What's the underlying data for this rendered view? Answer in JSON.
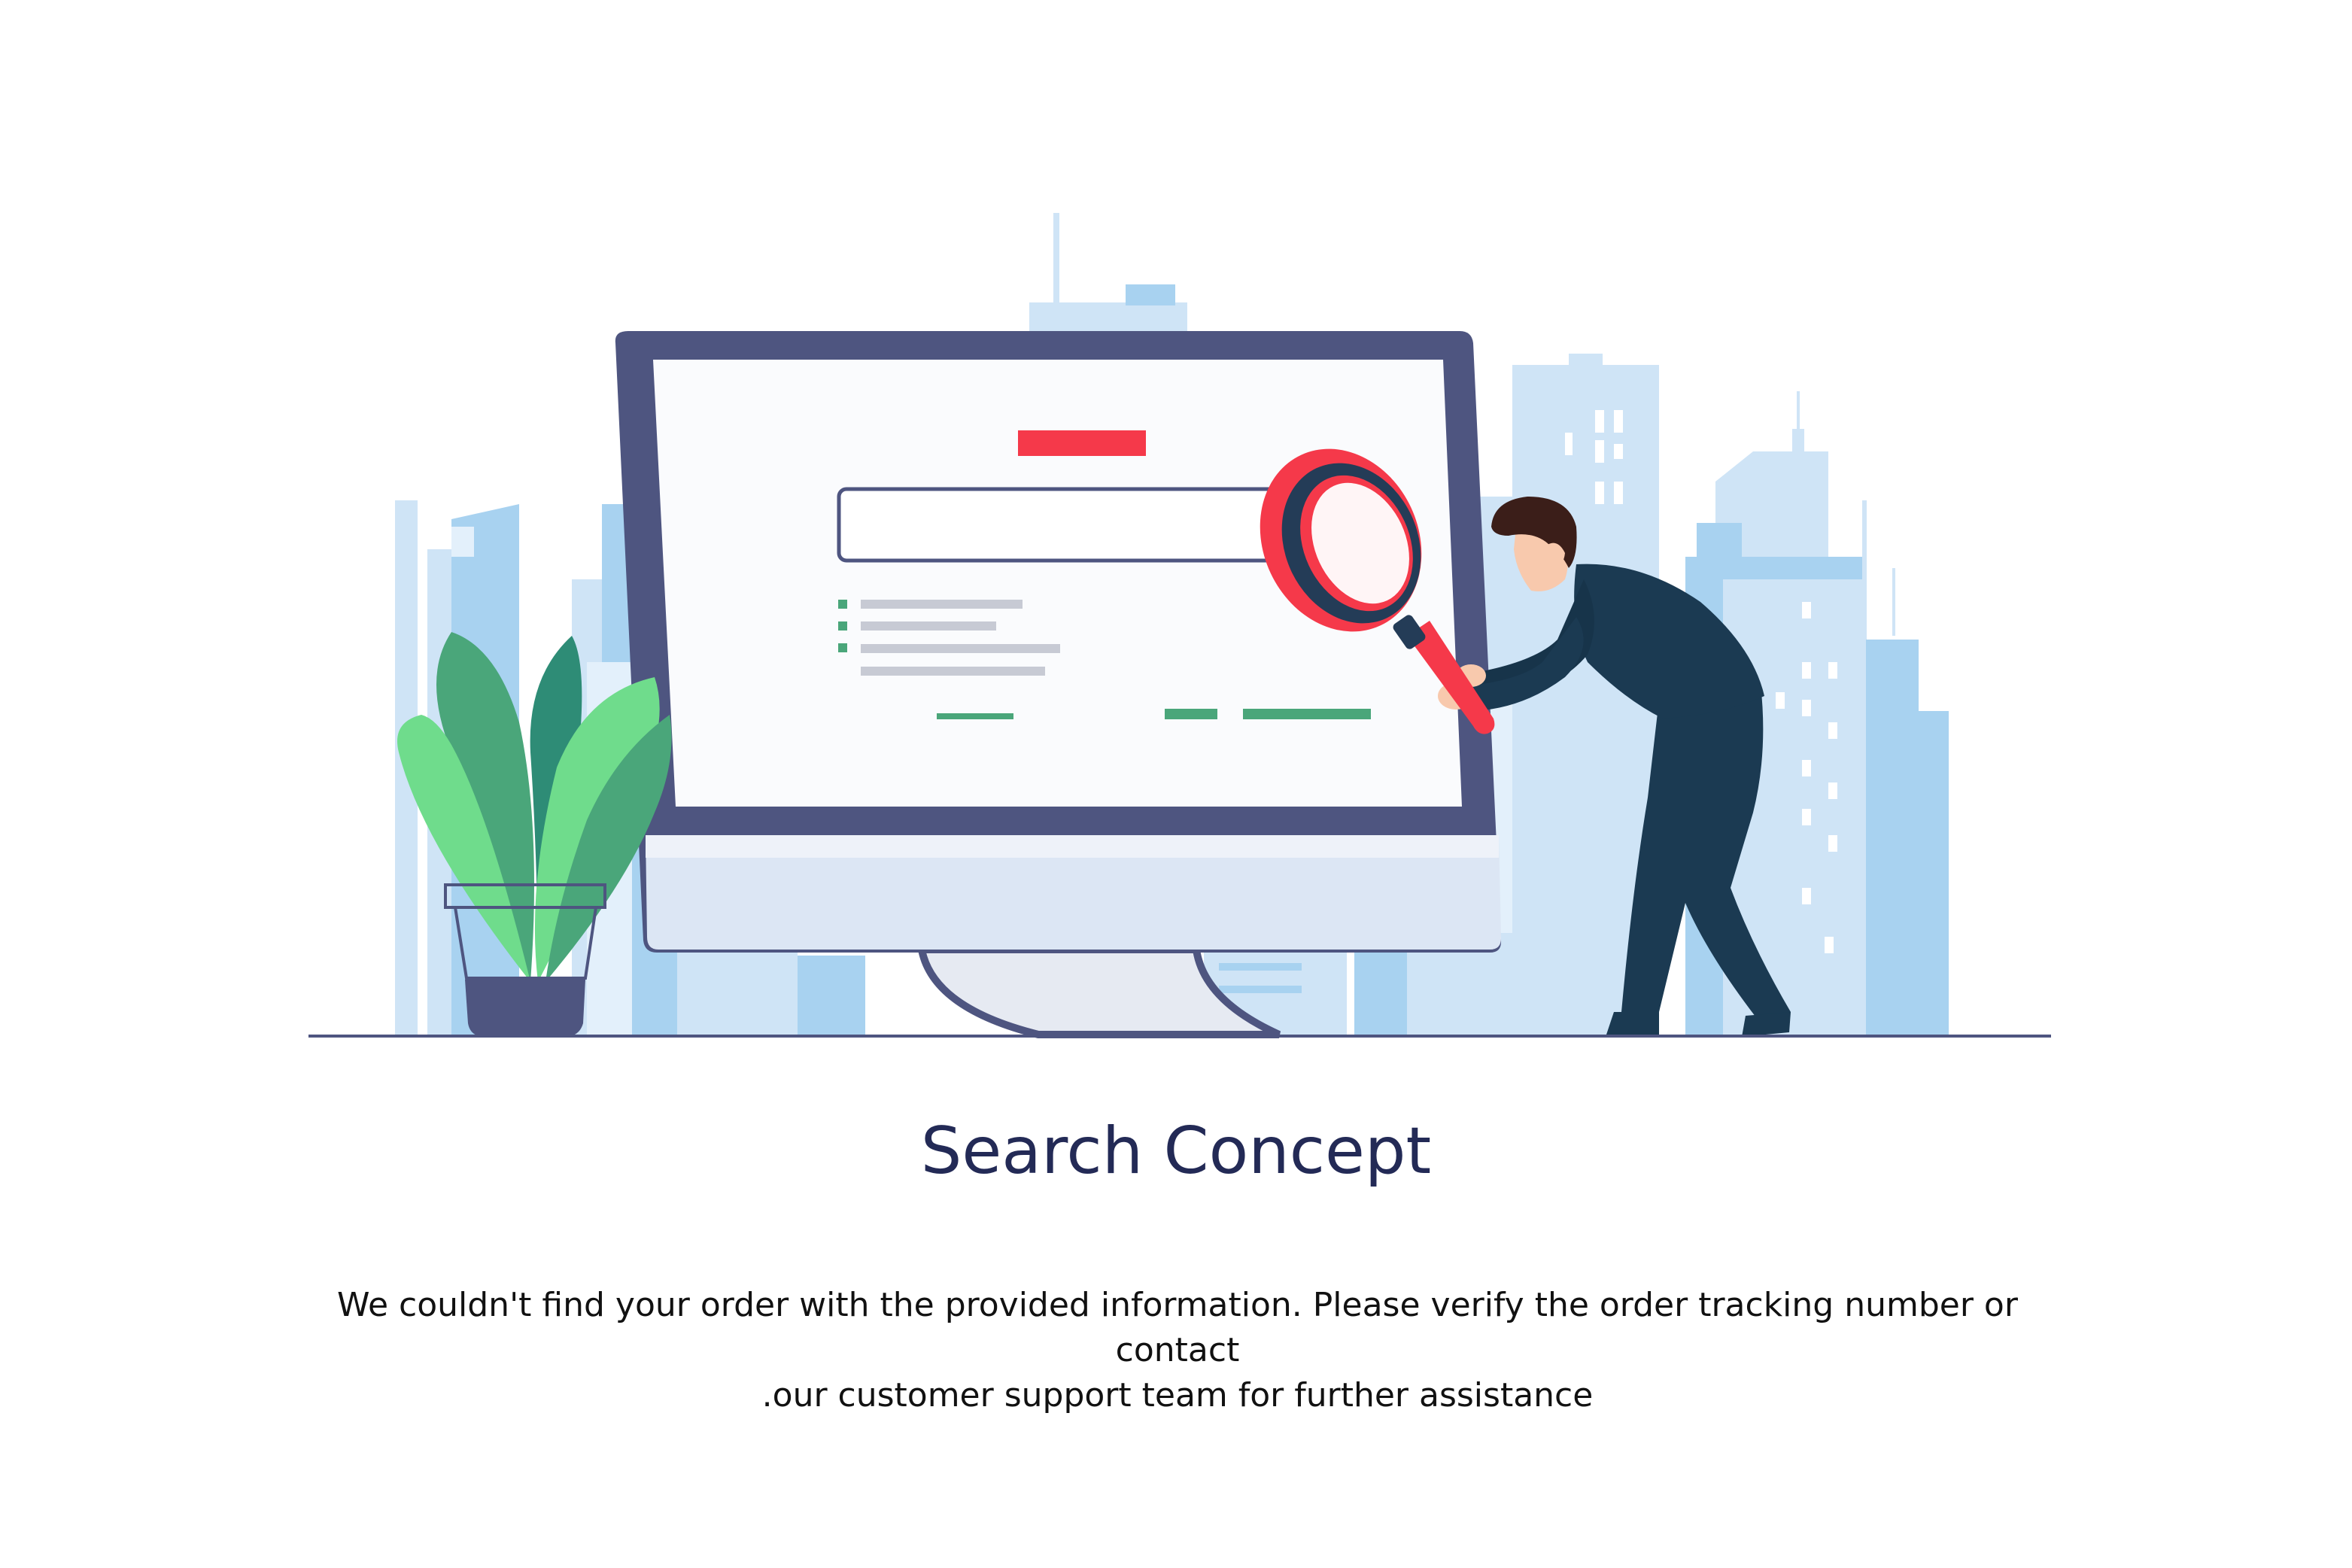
{
  "title": "Search Concept",
  "message": {
    "line1": "We couldn't find your order with the provided information. Please verify the order tracking number or contact",
    "line2": ".our customer support team for further assistance"
  },
  "colors": {
    "title": "#232a56",
    "message": "#111111",
    "monitor_frame": "#4e5580",
    "accent_red": "#f5394a",
    "accent_green": "#4aa67a",
    "skyline_light": "#cfe4f6",
    "skyline_mid": "#a8d2f0",
    "suit": "#1b3a52"
  },
  "icons": {
    "monitor": "monitor-icon",
    "magnifier": "magnifying-glass-icon",
    "plant": "potted-plant-icon",
    "person": "person-icon",
    "skyline": "city-skyline-icon"
  }
}
